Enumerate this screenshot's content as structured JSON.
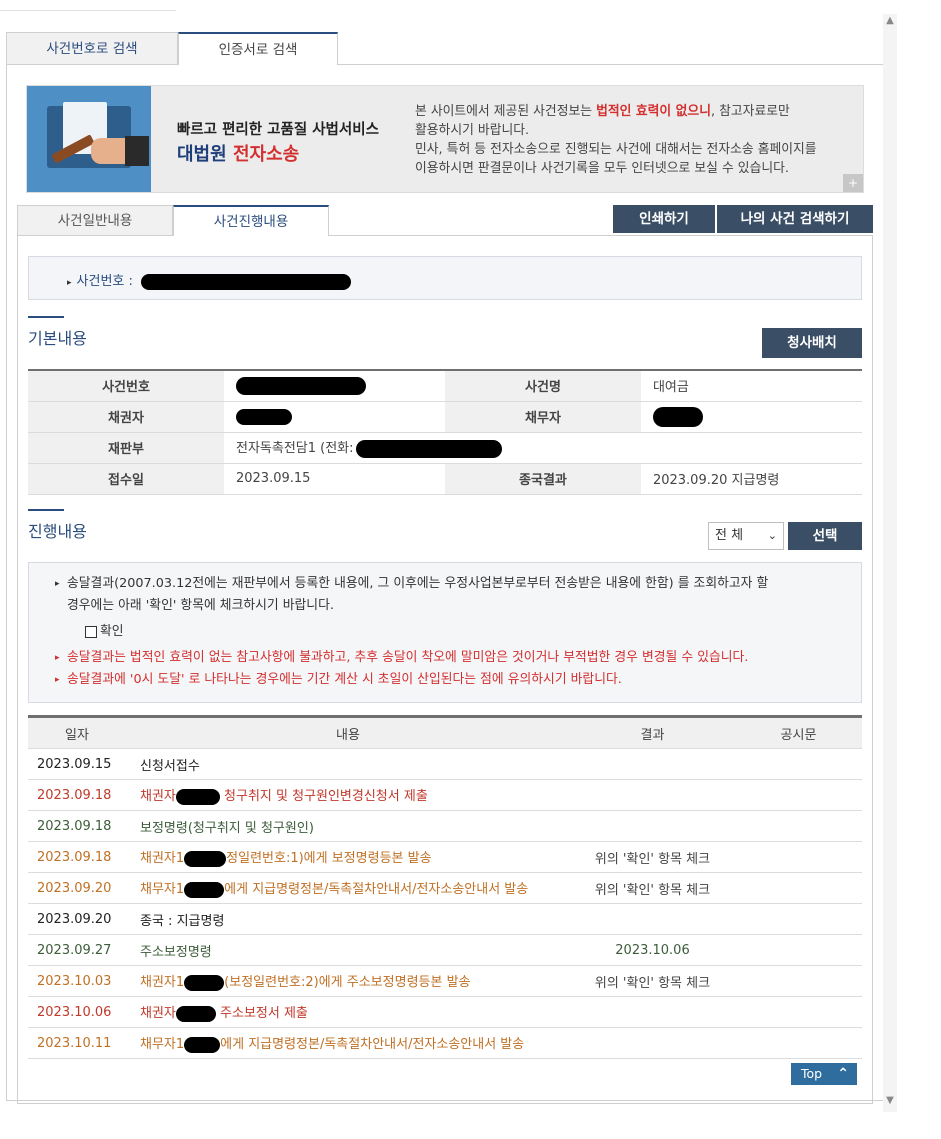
{
  "outer_tabs": [
    "사건번호로 검색",
    "인증서로 검색"
  ],
  "banner": {
    "title": "빠르고 편리한 고품질 사법서비스",
    "sub_blue": "대법원 ",
    "sub_red": "전자소송",
    "line1_pre": "본 사이트에서 제공된 사건정보는 ",
    "line1_hl": "법적인 효력이 없으니",
    "line1_post": ", 참고자료로만",
    "line2": "활용하시기 바랍니다.",
    "line3": "민사, 특허 등 전자소송으로 진행되는 사건에 대해서는 전자소송 홈페이지를",
    "line4": "이용하시면 판결문이나 사건기록을 모두 인터넷으로 보실 수 있습니다.",
    "plus": "+"
  },
  "inner_tabs": [
    "사건일반내용",
    "사건진행내용"
  ],
  "buttons": {
    "print": "인쇄하기",
    "my_search": "나의 사건 검색하기",
    "chung": "청사배치",
    "select": "선택",
    "top": "Top"
  },
  "case_label": "사건번호 :",
  "basic": {
    "title": "기본내용",
    "rows": [
      {
        "k1": "사건번호",
        "v1": "",
        "k2": "사건명",
        "v2": "대여금"
      },
      {
        "k1": "채권자",
        "v1": "",
        "k2": "채무자",
        "v2": ""
      },
      {
        "k1": "재판부",
        "v1": "전자독촉전담1 (전화:",
        "k2": "",
        "v2": ""
      },
      {
        "k1": "접수일",
        "v1": "2023.09.15",
        "k2": "종국결과",
        "v2": "2023.09.20 지급명령"
      }
    ]
  },
  "progress": {
    "title": "진행내용",
    "filter": "전 체",
    "notice1": "송달결과(2007.03.12전에는 재판부에서 등록한 내용에, 그 이후에는 우정사업본부로부터 전송받은 내용에 한함) 를 조회하고자 할",
    "notice1b": "경우에는 아래 '확인' 항목에 체크하시기 바랍니다.",
    "confirm": "확인",
    "notice2": "송달결과는 법적인 효력이 없는 참고사항에 불과하고, 추후 송달이 착오에 말미암은 것이거나 부적법한 경우 변경될 수 있습니다.",
    "notice3": "송달결과에 '0시 도달' 로 나타나는 경우에는 기간 계산 시 초일이 산입된다는 점에 유의하시기 바랍니다.",
    "headers": [
      "일자",
      "내용",
      "결과",
      "공시문"
    ],
    "rows": [
      {
        "date": "2023.09.15",
        "pre": "신청서접수",
        "post": "",
        "result": "",
        "kind": "black"
      },
      {
        "date": "2023.09.18",
        "pre": "채권자",
        "post": " 청구취지 및 청구원인변경신청서 제출",
        "result": "",
        "kind": "red"
      },
      {
        "date": "2023.09.18",
        "pre": "보정명령(청구취지 및 청구원인)",
        "post": "",
        "result": "",
        "kind": "green"
      },
      {
        "date": "2023.09.18",
        "pre": "채권자1",
        "post": "정일련번호:1)에게 보정명령등본 발송",
        "result": "위의 '확인' 항목 체크",
        "kind": "orange"
      },
      {
        "date": "2023.09.20",
        "pre": "채무자1",
        "post": "에게 지급명령정본/독촉절차안내서/전자소송안내서 발송",
        "result": "위의 '확인' 항목 체크",
        "kind": "orange"
      },
      {
        "date": "2023.09.20",
        "pre": "종국 : 지급명령",
        "post": "",
        "result": "",
        "kind": "black"
      },
      {
        "date": "2023.09.27",
        "pre": "주소보정명령",
        "post": "",
        "result": "2023.10.06",
        "kind": "green"
      },
      {
        "date": "2023.10.03",
        "pre": "채권자1",
        "post": "(보정일련번호:2)에게 주소보정명령등본 발송",
        "result": "위의 '확인' 항목 체크",
        "kind": "orange"
      },
      {
        "date": "2023.10.06",
        "pre": "채권자",
        "post": " 주소보정서 제출",
        "result": "",
        "kind": "red"
      },
      {
        "date": "2023.10.11",
        "pre": "채무자1",
        "post": "에게 지급명령정본/독촉절차안내서/전자소송안내서 발송",
        "result": "",
        "kind": "orange"
      }
    ]
  },
  "colors": {
    "navy": "#2b4c7e",
    "button": "#3a4e66",
    "red": "#d32f2f",
    "orange": "#c07025",
    "green": "#3d5c3a",
    "brown_red": "#c0392b"
  }
}
